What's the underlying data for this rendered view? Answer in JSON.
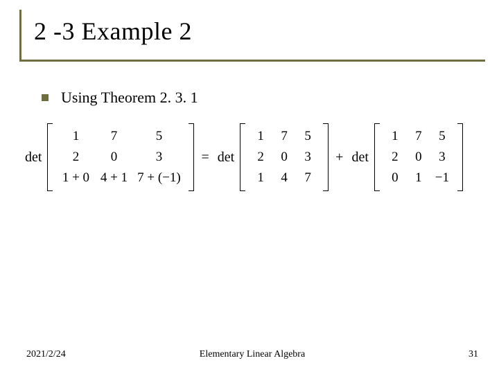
{
  "title": "2 -3 Example  2",
  "bullet": "Using Theorem 2. 3. 1",
  "equation": {
    "det_label": "det",
    "equals": "=",
    "plus": "+",
    "A": [
      [
        "1",
        "7",
        "5"
      ],
      [
        "2",
        "0",
        "3"
      ],
      [
        "1 + 0",
        "4 + 1",
        "7 + (−1)"
      ]
    ],
    "B": [
      [
        "1",
        "7",
        "5"
      ],
      [
        "2",
        "0",
        "3"
      ],
      [
        "1",
        "4",
        "7"
      ]
    ],
    "C": [
      [
        "1",
        "7",
        "5"
      ],
      [
        "2",
        "0",
        "3"
      ],
      [
        "0",
        "1",
        "−1"
      ]
    ]
  },
  "footer": {
    "date": "2021/2/24",
    "center": "Elementary Linear Algebra",
    "page": "31"
  },
  "colors": {
    "accent": "#6e6e3e"
  }
}
